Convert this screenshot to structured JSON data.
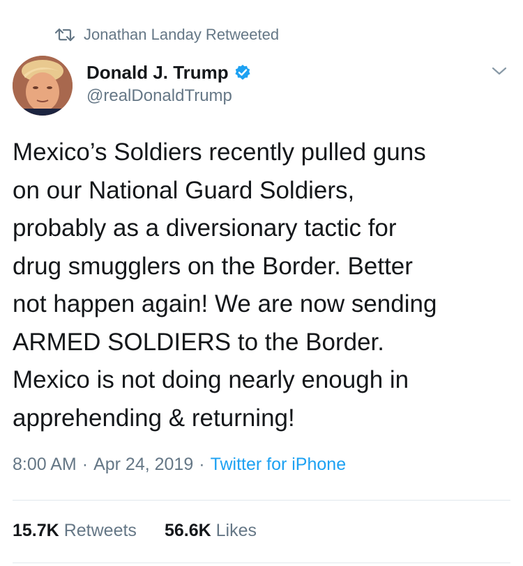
{
  "retweet": {
    "icon": "retweet-icon",
    "label": "Jonathan Landay Retweeted"
  },
  "author": {
    "display_name": "Donald J. Trump",
    "handle": "@realDonaldTrump",
    "verified_icon": "verified-badge-icon",
    "avatar": "avatar"
  },
  "menu": {
    "icon": "chevron-down-icon"
  },
  "tweet": {
    "text": "Mexico’s Soldiers recently pulled guns\non our National Guard Soldiers,\nprobably as a diversionary tactic for\ndrug smugglers on the Border. Better\nnot happen again! We are now sending\nARMED SOLDIERS to the Border.\nMexico is not doing nearly enough in\napprehending & returning!",
    "time": "8:00 AM",
    "separator": "·",
    "date": "Apr 24, 2019",
    "source": "Twitter for iPhone"
  },
  "stats": {
    "retweets_count": "15.7K",
    "retweets_label": "Retweets",
    "likes_count": "56.6K",
    "likes_label": "Likes"
  },
  "colors": {
    "text": "#14171a",
    "secondary": "#657786",
    "link": "#1da1f2",
    "verified": "#1da1f2",
    "divider": "#e1e8ed"
  }
}
